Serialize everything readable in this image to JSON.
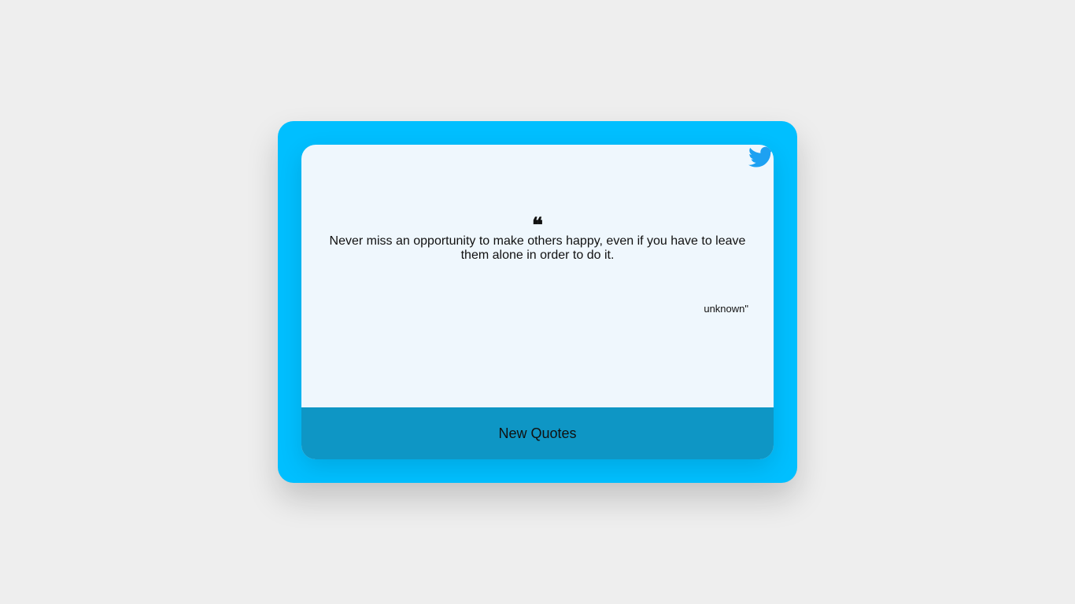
{
  "quote": {
    "mark": "❝",
    "text": "Never miss an opportunity to make others happy, even if you have to leave them alone in order to do it.",
    "author": "unknown\""
  },
  "actions": {
    "new_quote_label": "New Quotes",
    "share_icon": "twitter-icon"
  },
  "colors": {
    "page_background": "#eeeeee",
    "frame": "#00bfff",
    "card": "#eff7fd",
    "button": "#0e96c5",
    "twitter": "#1da1f2"
  }
}
